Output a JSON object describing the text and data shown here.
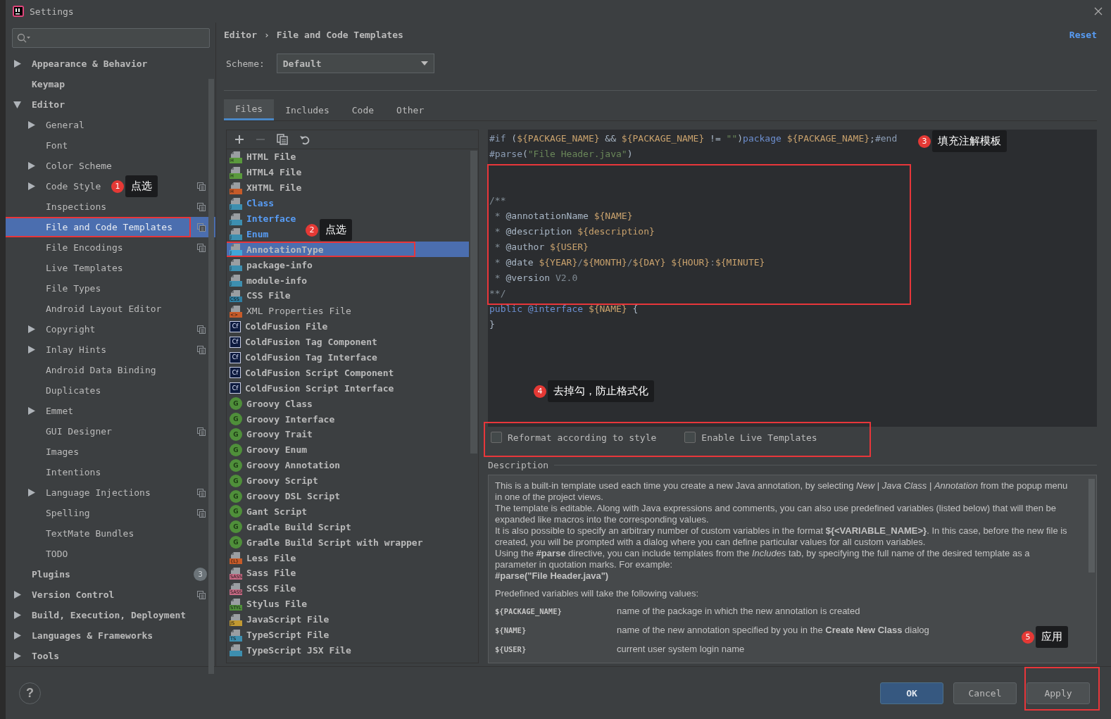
{
  "window": {
    "title": "Settings"
  },
  "sidebar": {
    "items": [
      {
        "label": "Appearance & Behavior",
        "expanded": false,
        "selected": false,
        "project_scoped": false
      },
      {
        "label": "Keymap",
        "selected": false,
        "project_scoped": false
      },
      {
        "label": "Editor",
        "expanded": true,
        "selected": false,
        "project_scoped": false,
        "children": [
          {
            "label": "General",
            "expanded": false,
            "selected": false,
            "project_scoped": false
          },
          {
            "label": "Font",
            "selected": false,
            "project_scoped": false
          },
          {
            "label": "Color Scheme",
            "expanded": false,
            "selected": false,
            "project_scoped": false
          },
          {
            "label": "Code Style",
            "expanded": false,
            "selected": false,
            "project_scoped": true
          },
          {
            "label": "Inspections",
            "selected": false,
            "project_scoped": true
          },
          {
            "label": "File and Code Templates",
            "selected": true,
            "project_scoped": true
          },
          {
            "label": "File Encodings",
            "selected": false,
            "project_scoped": true
          },
          {
            "label": "Live Templates",
            "selected": false,
            "project_scoped": false
          },
          {
            "label": "File Types",
            "selected": false,
            "project_scoped": false
          },
          {
            "label": "Android Layout Editor",
            "selected": false,
            "project_scoped": false
          },
          {
            "label": "Copyright",
            "expanded": false,
            "selected": false,
            "project_scoped": true
          },
          {
            "label": "Inlay Hints",
            "expanded": false,
            "selected": false,
            "project_scoped": true
          },
          {
            "label": "Android Data Binding",
            "selected": false,
            "project_scoped": false
          },
          {
            "label": "Duplicates",
            "selected": false,
            "project_scoped": false
          },
          {
            "label": "Emmet",
            "expanded": false,
            "selected": false,
            "project_scoped": false
          },
          {
            "label": "GUI Designer",
            "selected": false,
            "project_scoped": true
          },
          {
            "label": "Images",
            "selected": false,
            "project_scoped": false
          },
          {
            "label": "Intentions",
            "selected": false,
            "project_scoped": false
          },
          {
            "label": "Language Injections",
            "expanded": false,
            "selected": false,
            "project_scoped": true
          },
          {
            "label": "Spelling",
            "selected": false,
            "project_scoped": true
          },
          {
            "label": "TextMate Bundles",
            "selected": false,
            "project_scoped": false
          },
          {
            "label": "TODO",
            "selected": false,
            "project_scoped": false
          }
        ]
      },
      {
        "label": "Plugins",
        "badge": "3",
        "selected": false,
        "project_scoped": false
      },
      {
        "label": "Version Control",
        "expanded": false,
        "selected": false,
        "project_scoped": true
      },
      {
        "label": "Build, Execution, Deployment",
        "expanded": false,
        "selected": false,
        "project_scoped": false
      },
      {
        "label": "Languages & Frameworks",
        "expanded": false,
        "selected": false,
        "project_scoped": false
      },
      {
        "label": "Tools",
        "expanded": false,
        "selected": false,
        "project_scoped": false
      }
    ]
  },
  "breadcrumb": [
    "Editor",
    "›",
    "File and Code Templates"
  ],
  "reset_link": "Reset",
  "scheme": {
    "label": "Scheme:",
    "value": "Default"
  },
  "tabs": [
    {
      "label": "Files",
      "selected": true
    },
    {
      "label": "Includes",
      "selected": false
    },
    {
      "label": "Code",
      "selected": false
    },
    {
      "label": "Other",
      "selected": false
    }
  ],
  "toolbar": [
    {
      "kind": "add",
      "disabled": false
    },
    {
      "kind": "remove",
      "disabled": true
    },
    {
      "kind": "copy",
      "disabled": false
    },
    {
      "kind": "reset",
      "disabled": false
    }
  ],
  "templates": [
    {
      "name": "HTML File",
      "kind": "doc",
      "badge": "H",
      "color": "#5a9a3c",
      "bold": true,
      "modified": false,
      "selected": false
    },
    {
      "name": "HTML4 File",
      "kind": "doc",
      "badge": "H",
      "color": "#5a9a3c",
      "bold": true,
      "modified": false,
      "selected": false
    },
    {
      "name": "XHTML File",
      "kind": "doc",
      "badge": "H",
      "color": "#c75b29",
      "bold": true,
      "modified": false,
      "selected": false
    },
    {
      "name": "Class",
      "kind": "doc",
      "badge": "J",
      "color": "#3d8fb0",
      "bold": true,
      "modified": true,
      "selected": false
    },
    {
      "name": "Interface",
      "kind": "doc",
      "badge": "J",
      "color": "#3d8fb0",
      "bold": true,
      "modified": true,
      "selected": false
    },
    {
      "name": "Enum",
      "kind": "doc",
      "badge": "J",
      "color": "#3d8fb0",
      "bold": true,
      "modified": true,
      "selected": false
    },
    {
      "name": "AnnotationType",
      "kind": "doc",
      "badge": "J",
      "color": "#40a6d8",
      "bold": true,
      "modified": false,
      "selected": true
    },
    {
      "name": "package-info",
      "kind": "doc",
      "badge": "J",
      "color": "#3d8fb0",
      "bold": true,
      "modified": false,
      "selected": false
    },
    {
      "name": "module-info",
      "kind": "doc",
      "badge": "J",
      "color": "#3d8fb0",
      "bold": true,
      "modified": false,
      "selected": false
    },
    {
      "name": "CSS File",
      "kind": "doc",
      "badge": "CSS",
      "color": "#2f7fa3",
      "bold": true,
      "modified": false,
      "selected": false
    },
    {
      "name": "XML Properties File",
      "kind": "doc",
      "badge": "<>",
      "color": "#c75b29",
      "bold": false,
      "modified": false,
      "selected": false
    },
    {
      "name": "ColdFusion File",
      "kind": "square",
      "badge": "Cf",
      "color": "#0e1b3f",
      "bold": true,
      "modified": false,
      "selected": false
    },
    {
      "name": "ColdFusion Tag Component",
      "kind": "square",
      "badge": "Cf",
      "color": "#0e1b3f",
      "bold": true,
      "modified": false,
      "selected": false
    },
    {
      "name": "ColdFusion Tag Interface",
      "kind": "square",
      "badge": "Cf",
      "color": "#0e1b3f",
      "bold": true,
      "modified": false,
      "selected": false
    },
    {
      "name": "ColdFusion Script Component",
      "kind": "square",
      "badge": "Cf",
      "color": "#0e1b3f",
      "bold": true,
      "modified": false,
      "selected": false
    },
    {
      "name": "ColdFusion Script Interface",
      "kind": "square",
      "badge": "Cf",
      "color": "#0e1b3f",
      "bold": true,
      "modified": false,
      "selected": false
    },
    {
      "name": "Groovy Class",
      "kind": "circle",
      "badge": "G",
      "color": "#4f8f3a",
      "bold": true,
      "modified": false,
      "selected": false
    },
    {
      "name": "Groovy Interface",
      "kind": "circle",
      "badge": "G",
      "color": "#4f8f3a",
      "bold": true,
      "modified": false,
      "selected": false
    },
    {
      "name": "Groovy Trait",
      "kind": "circle",
      "badge": "G",
      "color": "#4f8f3a",
      "bold": true,
      "modified": false,
      "selected": false
    },
    {
      "name": "Groovy Enum",
      "kind": "circle",
      "badge": "G",
      "color": "#4f8f3a",
      "bold": true,
      "modified": false,
      "selected": false
    },
    {
      "name": "Groovy Annotation",
      "kind": "circle",
      "badge": "G",
      "color": "#4f8f3a",
      "bold": true,
      "modified": false,
      "selected": false
    },
    {
      "name": "Groovy Script",
      "kind": "circle",
      "badge": "G",
      "color": "#4f8f3a",
      "bold": true,
      "modified": false,
      "selected": false
    },
    {
      "name": "Groovy DSL Script",
      "kind": "circle",
      "badge": "G",
      "color": "#4f8f3a",
      "bold": true,
      "modified": false,
      "selected": false
    },
    {
      "name": "Gant Script",
      "kind": "circle",
      "badge": "G",
      "color": "#4f8f3a",
      "bold": true,
      "modified": false,
      "selected": false
    },
    {
      "name": "Gradle Build Script",
      "kind": "circle",
      "badge": "G",
      "color": "#4f8f3a",
      "bold": true,
      "modified": false,
      "selected": false
    },
    {
      "name": "Gradle Build Script with wrapper",
      "kind": "circle",
      "badge": "G",
      "color": "#4f8f3a",
      "bold": true,
      "modified": false,
      "selected": false
    },
    {
      "name": "Less File",
      "kind": "doc",
      "badge": "{L}",
      "color": "#c75b29",
      "bold": true,
      "modified": false,
      "selected": false
    },
    {
      "name": "Sass File",
      "kind": "doc",
      "badge": "SASS",
      "color": "#c76a84",
      "bold": true,
      "modified": false,
      "selected": false
    },
    {
      "name": "SCSS File",
      "kind": "doc",
      "badge": "SASS",
      "color": "#c76a84",
      "bold": true,
      "modified": false,
      "selected": false
    },
    {
      "name": "Stylus File",
      "kind": "doc",
      "badge": "STYL",
      "color": "#4f8f3a",
      "bold": true,
      "modified": false,
      "selected": false
    },
    {
      "name": "JavaScript File",
      "kind": "doc",
      "badge": "JS",
      "color": "#c29a32",
      "bold": true,
      "modified": false,
      "selected": false
    },
    {
      "name": "TypeScript File",
      "kind": "doc",
      "badge": "TS",
      "color": "#3d8fb0",
      "bold": true,
      "modified": false,
      "selected": false
    },
    {
      "name": "TypeScript JSX File",
      "kind": "doc",
      "color": "#3d8fb0",
      "bold": true,
      "modified": false,
      "selected": false
    }
  ],
  "code": [
    {
      "kind": "code",
      "tokens": [
        {
          "kind": "dir",
          "text": "#if"
        },
        {
          "kind": "text",
          "text": " ("
        },
        {
          "kind": "var",
          "text": "${PACKAGE_NAME}"
        },
        {
          "kind": "text",
          "text": " && "
        },
        {
          "kind": "var",
          "text": "${PACKAGE_NAME}"
        },
        {
          "kind": "text",
          "text": " != "
        },
        {
          "kind": "str",
          "text": "\"\""
        },
        {
          "kind": "text",
          "text": ")"
        },
        {
          "kind": "kw",
          "text": "package"
        },
        {
          "kind": "var",
          "text": " ${PACKAGE_NAME}"
        },
        {
          "kind": "text",
          "text": ";"
        },
        {
          "kind": "dir",
          "text": "#end"
        }
      ]
    },
    {
      "kind": "code",
      "tokens": [
        {
          "kind": "dir",
          "text": "#parse"
        },
        {
          "kind": "text",
          "text": "("
        },
        {
          "kind": "str",
          "text": "\"File Header.java\""
        },
        {
          "kind": "text",
          "text": ")"
        }
      ]
    },
    {
      "kind": "blank"
    },
    {
      "kind": "blank"
    },
    {
      "kind": "code",
      "tokens": [
        {
          "kind": "cmt",
          "text": "/**"
        }
      ]
    },
    {
      "kind": "code",
      "tokens": [
        {
          "kind": "cmt",
          "text": " * "
        },
        {
          "kind": "text",
          "text": "@annotationName "
        },
        {
          "kind": "var",
          "text": "${NAME}"
        }
      ]
    },
    {
      "kind": "code",
      "tokens": [
        {
          "kind": "cmt",
          "text": " * "
        },
        {
          "kind": "text",
          "text": "@description "
        },
        {
          "kind": "var",
          "text": "${description}"
        }
      ]
    },
    {
      "kind": "code",
      "tokens": [
        {
          "kind": "cmt",
          "text": " * "
        },
        {
          "kind": "text",
          "text": "@author "
        },
        {
          "kind": "var",
          "text": "${USER}"
        }
      ]
    },
    {
      "kind": "code",
      "tokens": [
        {
          "kind": "cmt",
          "text": " * "
        },
        {
          "kind": "text",
          "text": "@date "
        },
        {
          "kind": "var",
          "text": "${YEAR}"
        },
        {
          "kind": "cmt",
          "text": "/"
        },
        {
          "kind": "var",
          "text": "${MONTH}"
        },
        {
          "kind": "cmt",
          "text": "/"
        },
        {
          "kind": "var",
          "text": "${DAY}"
        },
        {
          "kind": "var",
          "text": " ${HOUR}"
        },
        {
          "kind": "cmt",
          "text": ":"
        },
        {
          "kind": "var",
          "text": "${MINUTE}"
        }
      ]
    },
    {
      "kind": "code",
      "tokens": [
        {
          "kind": "cmt",
          "text": " * "
        },
        {
          "kind": "text",
          "text": "@version "
        },
        {
          "kind": "cmt",
          "text": "V2.0"
        }
      ]
    },
    {
      "kind": "code",
      "tokens": [
        {
          "kind": "cmt",
          "text": "**/"
        }
      ]
    },
    {
      "kind": "code",
      "tokens": [
        {
          "kind": "kw",
          "text": "public @interface"
        },
        {
          "kind": "var",
          "text": " ${NAME}"
        },
        {
          "kind": "text",
          "text": " {"
        }
      ]
    },
    {
      "kind": "code",
      "tokens": [
        {
          "kind": "text",
          "text": "}"
        }
      ]
    }
  ],
  "options": [
    {
      "label": "Reformat according to style",
      "checked": false
    },
    {
      "label": "Enable Live Templates",
      "checked": false
    }
  ],
  "description": {
    "title": "Description",
    "paragraphs": [
      "This is a built-in template used each time you create a new Java annotation, by selecting *New* | *Java Class* | *Annotation* from the popup menu in one of the project views.",
      "The template is editable. Along with Java expressions and comments, you can also use predefined variables (listed below) that will then be expanded like macros into the corresponding values.",
      "It is also possible to specify an arbitrary number of custom variables in the format **${<VARIABLE_NAME>}**. In this case, before the new file is created, you will be prompted with a dialog where you can define particular values for all custom variables.",
      "Using the **#parse** directive, you can include templates from the *Includes* tab, by specifying the full name of the desired template as a parameter in quotation marks. For example:"
    ],
    "example": "#parse(\"File Header.java\")",
    "intro": "Predefined variables will take the following values:",
    "variables": [
      {
        "name": "${PACKAGE_NAME}",
        "meaning": "name of the package in which the new annotation is created"
      },
      {
        "name": "${NAME}",
        "meaning": "name of the new annotation specified by you in the **Create New Class** dialog"
      },
      {
        "name": "${USER}",
        "meaning": "current user system login name"
      }
    ]
  },
  "buttons": [
    {
      "label": "OK",
      "default": true
    },
    {
      "label": "Cancel",
      "default": false
    },
    {
      "label": "Apply",
      "default": false
    }
  ],
  "help": "?",
  "callouts": [
    {
      "number": "1",
      "text": "点选"
    },
    {
      "number": "2",
      "text": "点选"
    },
    {
      "number": "3",
      "text": "填充注解模板"
    },
    {
      "number": "4",
      "text": "去掉勾，防止格式化"
    },
    {
      "number": "5",
      "text": "应用"
    }
  ]
}
